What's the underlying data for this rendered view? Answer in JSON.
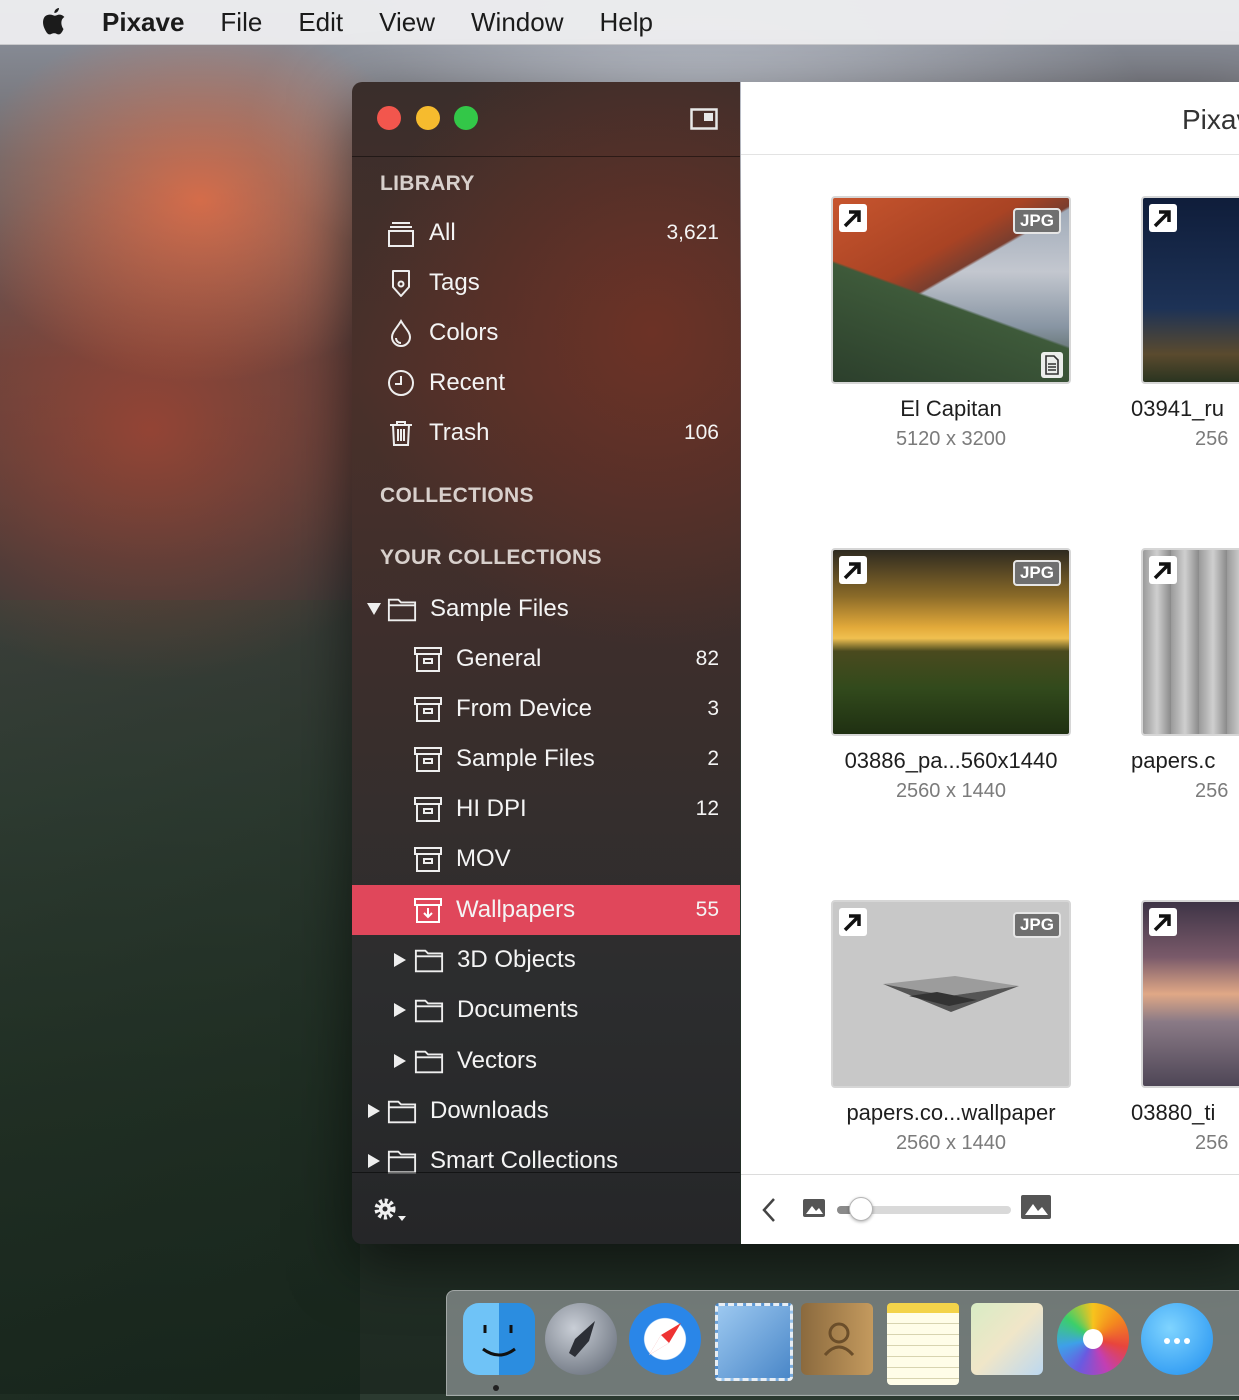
{
  "menubar": {
    "app_name": "Pixave",
    "items": [
      "File",
      "Edit",
      "View",
      "Window",
      "Help"
    ]
  },
  "sidebar": {
    "library_header": "LIBRARY",
    "library": [
      {
        "label": "All",
        "count": "3,621",
        "icon": "stack-icon"
      },
      {
        "label": "Tags",
        "count": "",
        "icon": "tag-icon"
      },
      {
        "label": "Colors",
        "count": "",
        "icon": "drop-icon"
      },
      {
        "label": "Recent",
        "count": "",
        "icon": "clock-icon"
      },
      {
        "label": "Trash",
        "count": "106",
        "icon": "trash-icon"
      }
    ],
    "collections_header": "COLLECTIONS",
    "your_collections_header": "YOUR COLLECTIONS",
    "sample_files": {
      "label": "Sample Files",
      "expanded": true
    },
    "sample_children": [
      {
        "label": "General",
        "count": "82"
      },
      {
        "label": "From Device",
        "count": "3"
      },
      {
        "label": "Sample Files",
        "count": "2"
      },
      {
        "label": "HI DPI",
        "count": "12"
      },
      {
        "label": "MOV",
        "count": ""
      },
      {
        "label": "Wallpapers",
        "count": "55",
        "selected": true
      }
    ],
    "sub_folders": [
      {
        "label": "3D Objects"
      },
      {
        "label": "Documents"
      },
      {
        "label": "Vectors"
      }
    ],
    "top_folders": [
      {
        "label": "Downloads"
      },
      {
        "label": "Smart Collections"
      }
    ]
  },
  "content": {
    "title": "Pixave",
    "tiles": [
      {
        "name": "El Capitan",
        "dims": "5120 x 3200",
        "badge": "JPG"
      },
      {
        "name": "03941_ru",
        "dims": "256",
        "badge": ""
      },
      {
        "name": "03886_pa...560x1440",
        "dims": "2560 x 1440",
        "badge": "JPG"
      },
      {
        "name": "papers.c",
        "dims": "256",
        "badge": ""
      },
      {
        "name": "papers.co...wallpaper",
        "dims": "2560 x 1440",
        "badge": "JPG"
      },
      {
        "name": "03880_ti",
        "dims": "256",
        "badge": ""
      }
    ],
    "zoom_level": 0.08
  },
  "colors": {
    "selection": "#e0475b",
    "close": "#f2564d",
    "minimize": "#f6bb2e",
    "zoom": "#33c748"
  },
  "dock": {
    "apps": [
      "finder-icon",
      "launchpad-icon",
      "safari-icon",
      "mail-icon",
      "contacts-icon",
      "notes-icon",
      "maps-icon",
      "photos-icon",
      "messages-icon"
    ]
  }
}
